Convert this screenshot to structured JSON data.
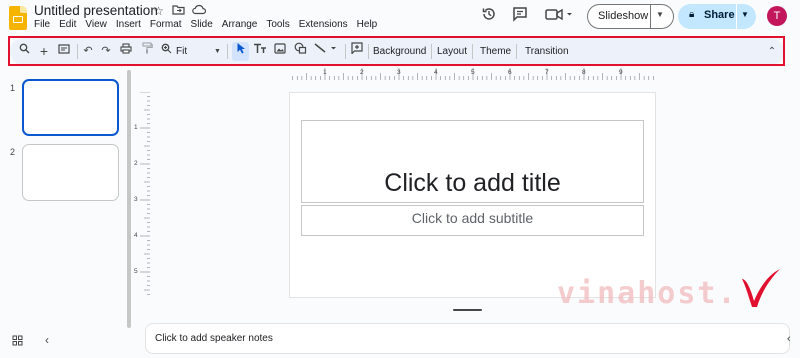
{
  "app": {
    "title": "Untitled presentation",
    "brand_color": "#f5b400"
  },
  "title_icons": [
    "star-icon",
    "move-to-folder-icon",
    "cloud-status-icon"
  ],
  "menu": [
    "File",
    "Edit",
    "View",
    "Insert",
    "Format",
    "Slide",
    "Arrange",
    "Tools",
    "Extensions",
    "Help"
  ],
  "header": {
    "history_icon": "version-history-icon",
    "comments_icon": "comments-icon",
    "meet_icon": "video-call-icon",
    "slideshow_label": "Slideshow",
    "share_label": "Share",
    "avatar_initial": "T",
    "share_color": "#c2e7ff"
  },
  "toolbar": {
    "zoom_label": "Fit",
    "background_label": "Background",
    "layout_label": "Layout",
    "theme_label": "Theme",
    "transition_label": "Transition",
    "highlight_color": "#e0102e"
  },
  "slides": [
    {
      "number": "1"
    },
    {
      "number": "2"
    }
  ],
  "ruler": {
    "horizontal": [
      "1",
      "2",
      "3",
      "4",
      "5",
      "6",
      "7",
      "8",
      "9"
    ],
    "vertical": [
      "1",
      "2",
      "3",
      "4",
      "5"
    ]
  },
  "slide_canvas": {
    "title_placeholder": "Click to add title",
    "subtitle_placeholder": "Click to add subtitle"
  },
  "notes": {
    "placeholder": "Click to add speaker notes"
  },
  "watermark": {
    "text": "vinahost.",
    "color": "#e0102e"
  }
}
